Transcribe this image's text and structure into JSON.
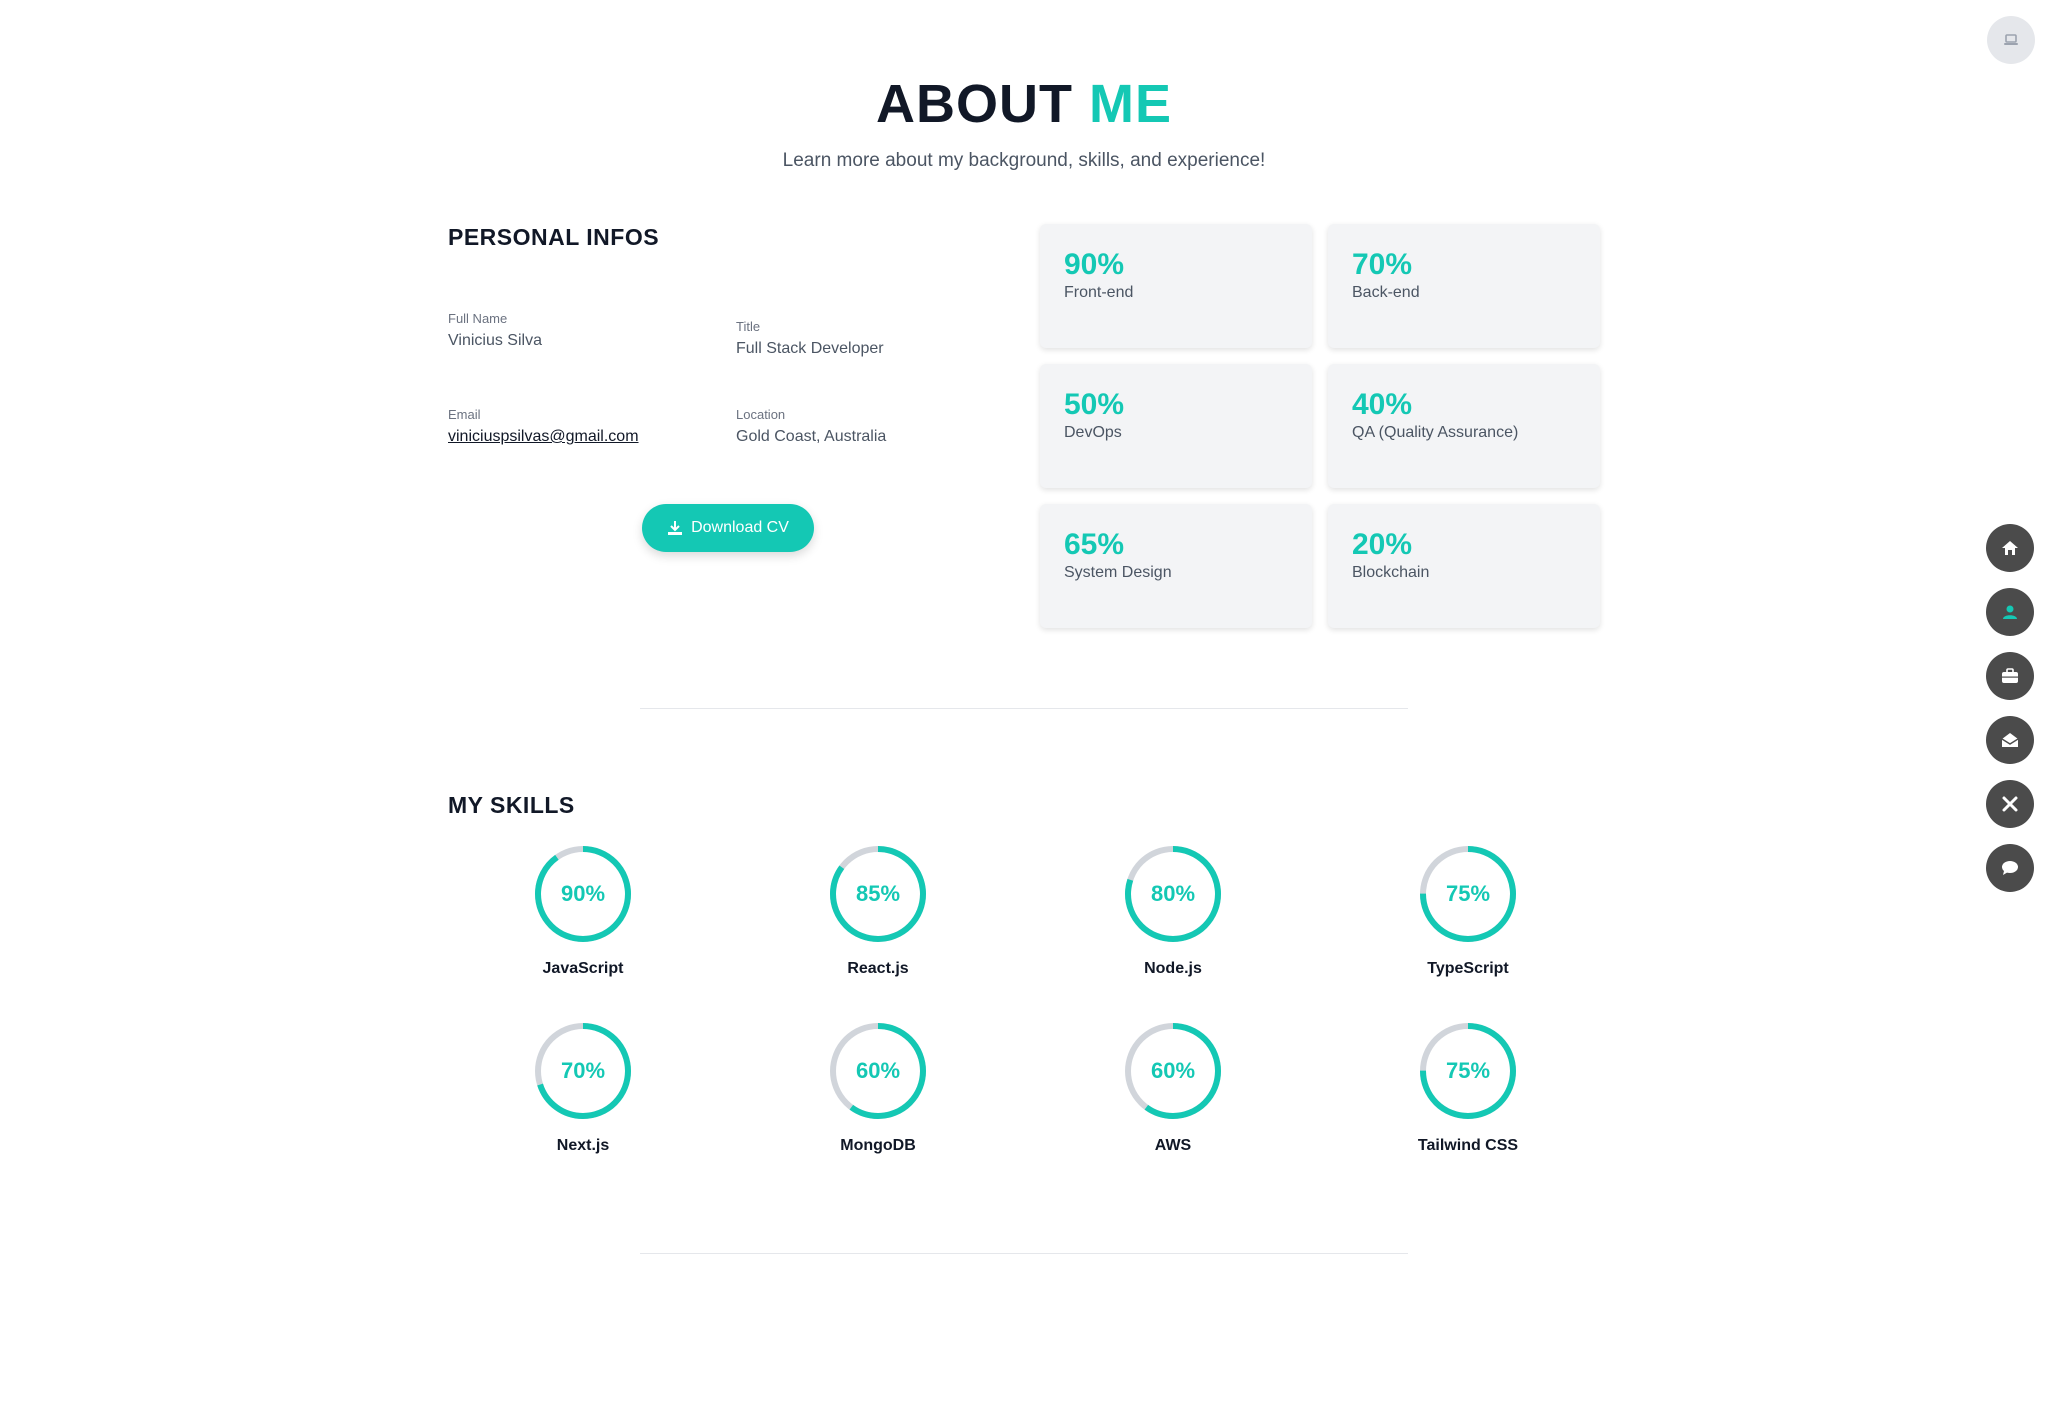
{
  "header": {
    "title_main": "ABOUT",
    "title_accent": "ME",
    "subtitle": "Learn more about my background, skills, and experience!"
  },
  "colors": {
    "accent": "#14c8b4",
    "text": "#111827",
    "muted": "#4b5563",
    "nav_bg": "#4b4b4b"
  },
  "theme_toggle": {
    "icon": "laptop-icon"
  },
  "personal": {
    "title": "PERSONAL INFOS",
    "fields": [
      {
        "label": "Full Name",
        "value": "Vinicius Silva"
      },
      {
        "label": "Title",
        "value": "Full Stack Developer"
      },
      {
        "label": "Email",
        "value": "viniciuspsilvas@gmail.com"
      },
      {
        "label": "Location",
        "value": "Gold Coast, Australia"
      }
    ],
    "download_label": "Download CV"
  },
  "stats": [
    {
      "pct": "90%",
      "name": "Front-end"
    },
    {
      "pct": "70%",
      "name": "Back-end"
    },
    {
      "pct": "50%",
      "name": "DevOps"
    },
    {
      "pct": "40%",
      "name": "QA (Quality Assurance)"
    },
    {
      "pct": "65%",
      "name": "System Design"
    },
    {
      "pct": "20%",
      "name": "Blockchain"
    }
  ],
  "skills": {
    "title": "MY SKILLS",
    "items": [
      {
        "name": "JavaScript",
        "value": 90,
        "label": "90%"
      },
      {
        "name": "React.js",
        "value": 85,
        "label": "85%"
      },
      {
        "name": "Node.js",
        "value": 80,
        "label": "80%"
      },
      {
        "name": "TypeScript",
        "value": 75,
        "label": "75%"
      },
      {
        "name": "Next.js",
        "value": 70,
        "label": "70%"
      },
      {
        "name": "MongoDB",
        "value": 60,
        "label": "60%"
      },
      {
        "name": "AWS",
        "value": 60,
        "label": "60%"
      },
      {
        "name": "Tailwind CSS",
        "value": 75,
        "label": "75%"
      }
    ]
  },
  "side_nav": [
    {
      "icon": "home-icon",
      "active": false
    },
    {
      "icon": "user-icon",
      "active": true
    },
    {
      "icon": "briefcase-icon",
      "active": false
    },
    {
      "icon": "mail-icon",
      "active": false
    },
    {
      "icon": "tools-icon",
      "active": false
    },
    {
      "icon": "chat-icon",
      "active": false
    }
  ]
}
